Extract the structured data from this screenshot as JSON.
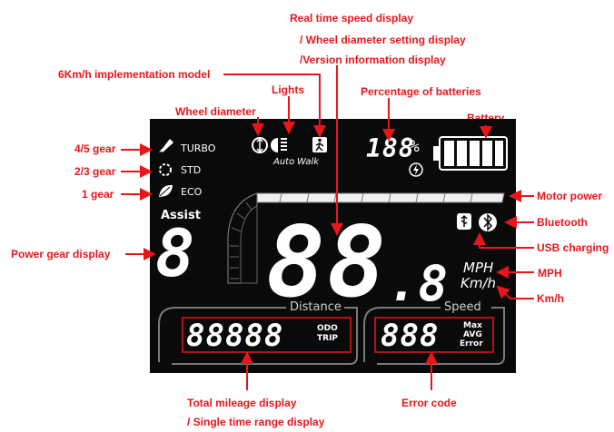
{
  "annotations": {
    "realtime_speed": [
      "Real time speed display",
      "/ Wheel diameter setting display",
      "/Version information display"
    ],
    "six_kmh": "6Km/h implementation model",
    "lights": "Lights",
    "percentage_batteries": "Percentage of batteries",
    "wheel_diameter": "Wheel diameter",
    "battery": "Battery",
    "gear_45": "4/5 gear",
    "gear_23": "2/3 gear",
    "gear_1": "1 gear",
    "motor_power": "Motor power",
    "bluetooth": "Bluetooth",
    "power_gear_display": "Power gear display",
    "usb_charging": "USB charging",
    "mph": "MPH",
    "kmh": "Km/h",
    "total_mileage": [
      "Total mileage display",
      "/ Single time range display"
    ],
    "error_code": "Error code"
  },
  "display": {
    "turbo": "TURBO",
    "std": "STD",
    "eco": "ECO",
    "assist": "Assist",
    "assist_digit": "8",
    "auto": "Auto",
    "walk": "Walk",
    "battery_percent": "188",
    "percent_sign": "%",
    "speed_digits": "88",
    "speed_decimal": ".8",
    "unit_mph": "MPH",
    "unit_kmh": "Km/h",
    "distance_title": "Distance",
    "speed_title": "Speed",
    "odometer_digits": "88888",
    "odo": "ODO",
    "trip": "TRIP",
    "speed_stat_digits": "888",
    "max": "Max",
    "avg": "AVG",
    "error": "Error",
    "colors": {
      "annotation": "#e8161b",
      "panel": "#0a0a0a",
      "segment": "#ffffff",
      "frame": "#7a7a7a"
    }
  }
}
